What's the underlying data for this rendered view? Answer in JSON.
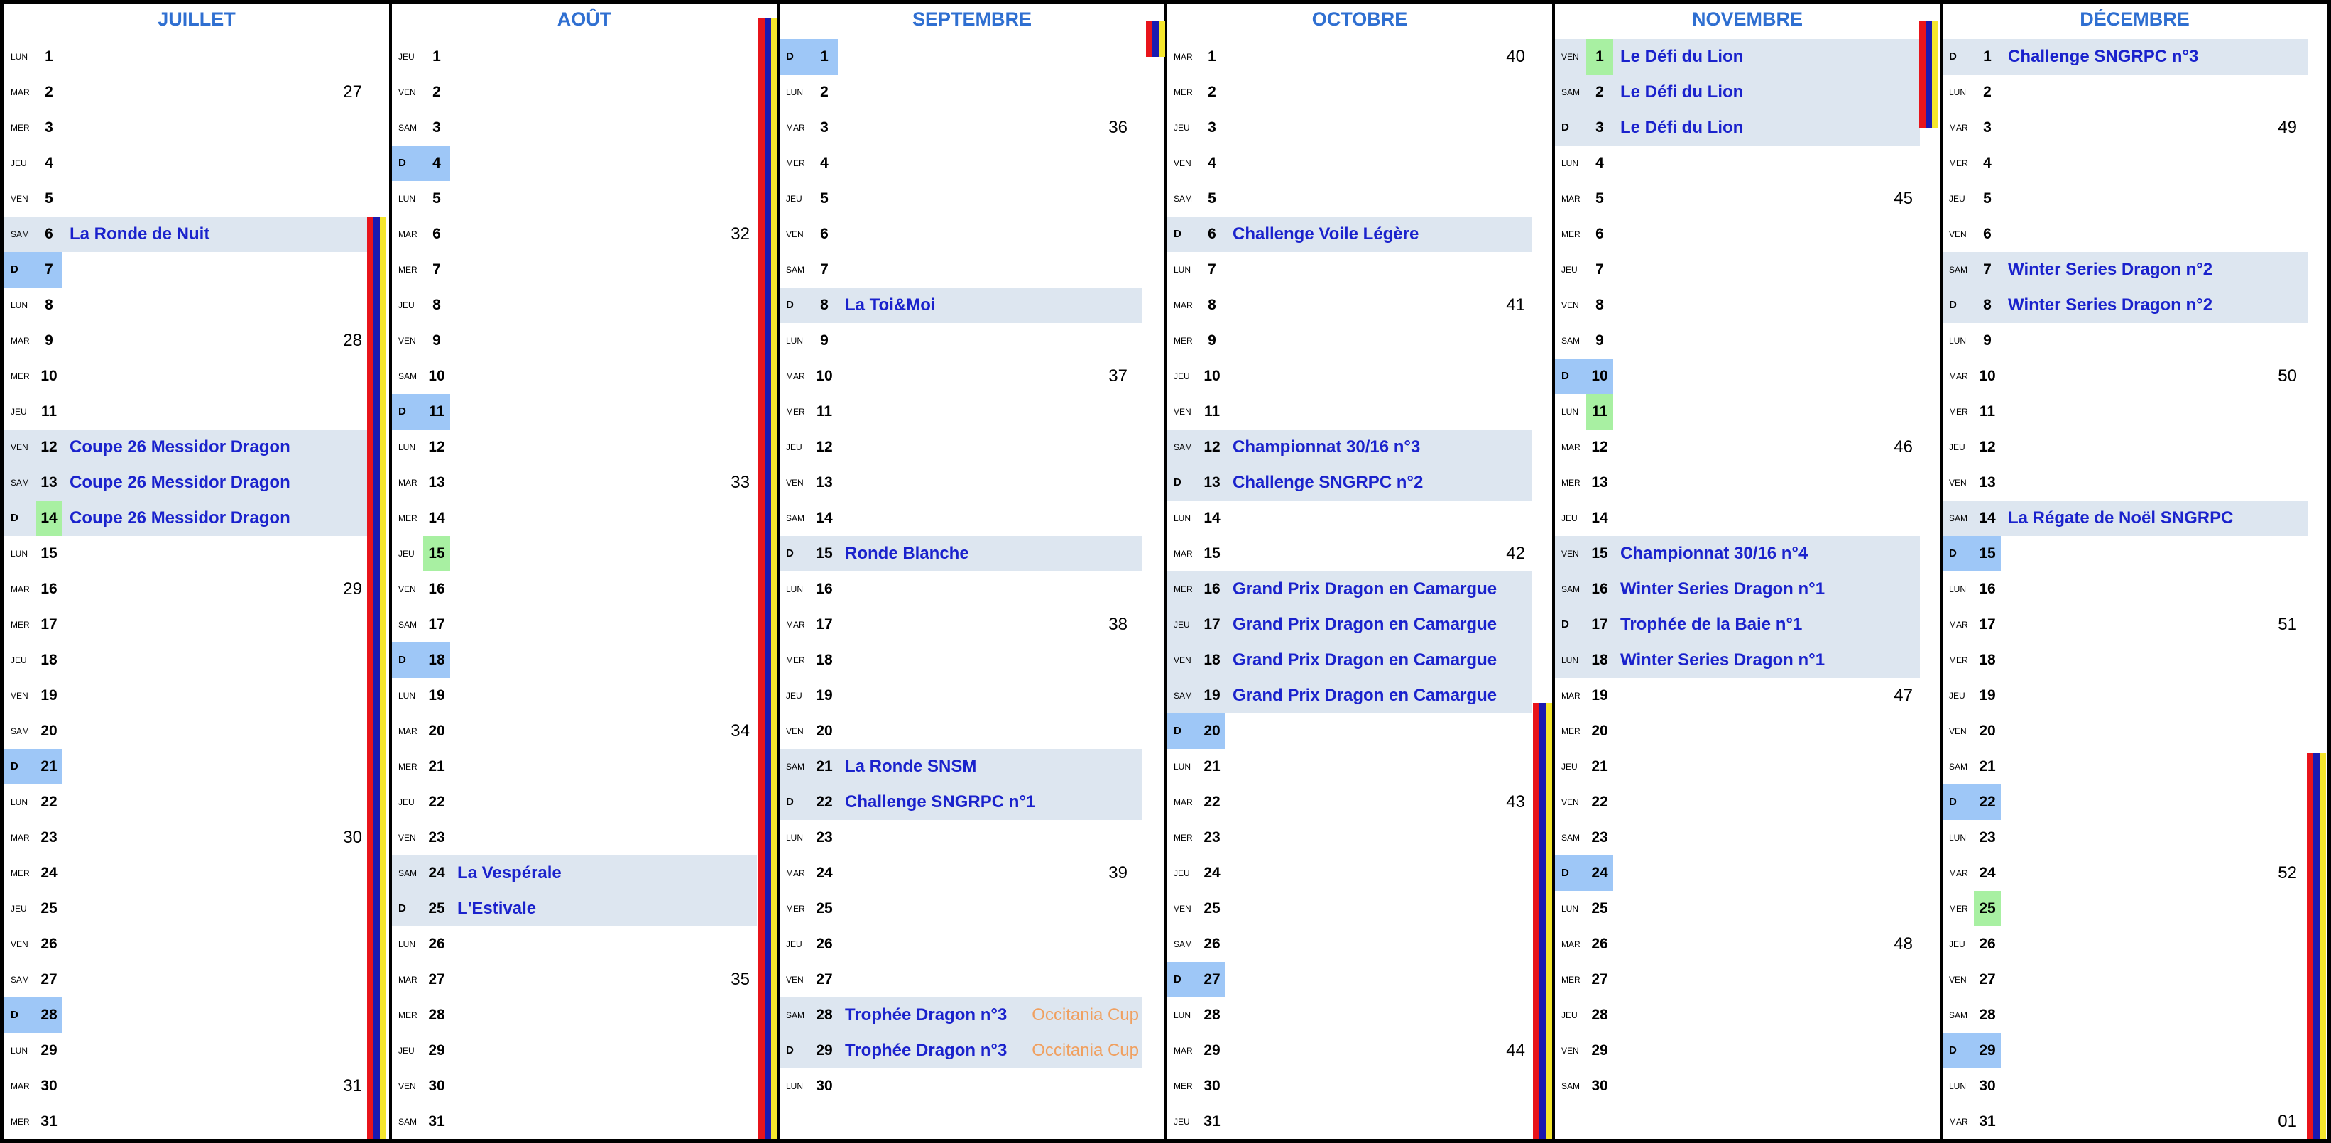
{
  "colors": {
    "month_title": "#2f6fd1",
    "event_text": "#1a22cc",
    "event_note": "#f0a060",
    "event_bg": "#dde6f0",
    "sunday_bg": "#9ec7f7",
    "holiday_bg": "#a8f0a2",
    "stripe": [
      "#e8141b",
      "#1a1ab0",
      "#f5e62c"
    ]
  },
  "months": [
    {
      "name": "JUILLET",
      "days": [
        {
          "wd": "LUN",
          "n": "1"
        },
        {
          "wd": "MAR",
          "n": "2",
          "week": "27"
        },
        {
          "wd": "MER",
          "n": "3"
        },
        {
          "wd": "JEU",
          "n": "4"
        },
        {
          "wd": "VEN",
          "n": "5"
        },
        {
          "wd": "SAM",
          "n": "6",
          "ev": "La Ronde de Nuit"
        },
        {
          "wd": "D",
          "n": "7",
          "sun": true
        },
        {
          "wd": "LUN",
          "n": "8"
        },
        {
          "wd": "MAR",
          "n": "9",
          "week": "28"
        },
        {
          "wd": "MER",
          "n": "10"
        },
        {
          "wd": "JEU",
          "n": "11"
        },
        {
          "wd": "VEN",
          "n": "12",
          "ev": "Coupe 26 Messidor Dragon"
        },
        {
          "wd": "SAM",
          "n": "13",
          "ev": "Coupe 26 Messidor Dragon"
        },
        {
          "wd": "D",
          "n": "14",
          "holiday": true,
          "ev": "Coupe 26 Messidor Dragon"
        },
        {
          "wd": "LUN",
          "n": "15"
        },
        {
          "wd": "MAR",
          "n": "16",
          "week": "29"
        },
        {
          "wd": "MER",
          "n": "17"
        },
        {
          "wd": "JEU",
          "n": "18"
        },
        {
          "wd": "VEN",
          "n": "19"
        },
        {
          "wd": "SAM",
          "n": "20"
        },
        {
          "wd": "D",
          "n": "21",
          "sun": true
        },
        {
          "wd": "LUN",
          "n": "22"
        },
        {
          "wd": "MAR",
          "n": "23",
          "week": "30"
        },
        {
          "wd": "MER",
          "n": "24"
        },
        {
          "wd": "JEU",
          "n": "25"
        },
        {
          "wd": "VEN",
          "n": "26"
        },
        {
          "wd": "SAM",
          "n": "27"
        },
        {
          "wd": "D",
          "n": "28",
          "sun": true
        },
        {
          "wd": "LUN",
          "n": "29"
        },
        {
          "wd": "MAR",
          "n": "30",
          "week": "31"
        },
        {
          "wd": "MER",
          "n": "31"
        }
      ]
    },
    {
      "name": "AOÛT",
      "days": [
        {
          "wd": "JEU",
          "n": "1"
        },
        {
          "wd": "VEN",
          "n": "2"
        },
        {
          "wd": "SAM",
          "n": "3"
        },
        {
          "wd": "D",
          "n": "4",
          "sun": true
        },
        {
          "wd": "LUN",
          "n": "5"
        },
        {
          "wd": "MAR",
          "n": "6",
          "week": "32"
        },
        {
          "wd": "MER",
          "n": "7"
        },
        {
          "wd": "JEU",
          "n": "8"
        },
        {
          "wd": "VEN",
          "n": "9"
        },
        {
          "wd": "SAM",
          "n": "10"
        },
        {
          "wd": "D",
          "n": "11",
          "sun": true
        },
        {
          "wd": "LUN",
          "n": "12"
        },
        {
          "wd": "MAR",
          "n": "13",
          "week": "33"
        },
        {
          "wd": "MER",
          "n": "14"
        },
        {
          "wd": "JEU",
          "n": "15",
          "holiday": true
        },
        {
          "wd": "VEN",
          "n": "16"
        },
        {
          "wd": "SAM",
          "n": "17"
        },
        {
          "wd": "D",
          "n": "18",
          "sun": true
        },
        {
          "wd": "LUN",
          "n": "19"
        },
        {
          "wd": "MAR",
          "n": "20",
          "week": "34"
        },
        {
          "wd": "MER",
          "n": "21"
        },
        {
          "wd": "JEU",
          "n": "22"
        },
        {
          "wd": "VEN",
          "n": "23"
        },
        {
          "wd": "SAM",
          "n": "24",
          "ev": "La Vespérale"
        },
        {
          "wd": "D",
          "n": "25",
          "ev": "L'Estivale"
        },
        {
          "wd": "LUN",
          "n": "26"
        },
        {
          "wd": "MAR",
          "n": "27",
          "week": "35"
        },
        {
          "wd": "MER",
          "n": "28"
        },
        {
          "wd": "JEU",
          "n": "29"
        },
        {
          "wd": "VEN",
          "n": "30"
        },
        {
          "wd": "SAM",
          "n": "31"
        }
      ]
    },
    {
      "name": "SEPTEMBRE",
      "days": [
        {
          "wd": "D",
          "n": "1",
          "sun": true
        },
        {
          "wd": "LUN",
          "n": "2"
        },
        {
          "wd": "MAR",
          "n": "3",
          "week": "36"
        },
        {
          "wd": "MER",
          "n": "4"
        },
        {
          "wd": "JEU",
          "n": "5"
        },
        {
          "wd": "VEN",
          "n": "6"
        },
        {
          "wd": "SAM",
          "n": "7"
        },
        {
          "wd": "D",
          "n": "8",
          "ev": "La Toi&Moi"
        },
        {
          "wd": "LUN",
          "n": "9"
        },
        {
          "wd": "MAR",
          "n": "10",
          "week": "37"
        },
        {
          "wd": "MER",
          "n": "11"
        },
        {
          "wd": "JEU",
          "n": "12"
        },
        {
          "wd": "VEN",
          "n": "13"
        },
        {
          "wd": "SAM",
          "n": "14"
        },
        {
          "wd": "D",
          "n": "15",
          "ev": "Ronde Blanche"
        },
        {
          "wd": "LUN",
          "n": "16"
        },
        {
          "wd": "MAR",
          "n": "17",
          "week": "38"
        },
        {
          "wd": "MER",
          "n": "18"
        },
        {
          "wd": "JEU",
          "n": "19"
        },
        {
          "wd": "VEN",
          "n": "20"
        },
        {
          "wd": "SAM",
          "n": "21",
          "ev": "La Ronde SNSM"
        },
        {
          "wd": "D",
          "n": "22",
          "ev": "Challenge SNGRPC n°1"
        },
        {
          "wd": "LUN",
          "n": "23"
        },
        {
          "wd": "MAR",
          "n": "24",
          "week": "39"
        },
        {
          "wd": "MER",
          "n": "25"
        },
        {
          "wd": "JEU",
          "n": "26"
        },
        {
          "wd": "VEN",
          "n": "27"
        },
        {
          "wd": "SAM",
          "n": "28",
          "ev": "Trophée Dragon n°3",
          "note": "Occitania Cup"
        },
        {
          "wd": "D",
          "n": "29",
          "ev": "Trophée Dragon n°3",
          "note": "Occitania Cup"
        },
        {
          "wd": "LUN",
          "n": "30"
        }
      ]
    },
    {
      "name": "OCTOBRE",
      "days": [
        {
          "wd": "MAR",
          "n": "1",
          "week": "40"
        },
        {
          "wd": "MER",
          "n": "2"
        },
        {
          "wd": "JEU",
          "n": "3"
        },
        {
          "wd": "VEN",
          "n": "4"
        },
        {
          "wd": "SAM",
          "n": "5"
        },
        {
          "wd": "D",
          "n": "6",
          "ev": "Challenge Voile Légère"
        },
        {
          "wd": "LUN",
          "n": "7"
        },
        {
          "wd": "MAR",
          "n": "8",
          "week": "41"
        },
        {
          "wd": "MER",
          "n": "9"
        },
        {
          "wd": "JEU",
          "n": "10"
        },
        {
          "wd": "VEN",
          "n": "11"
        },
        {
          "wd": "SAM",
          "n": "12",
          "ev": "Championnat 30/16 n°3"
        },
        {
          "wd": "D",
          "n": "13",
          "ev": "Challenge SNGRPC n°2"
        },
        {
          "wd": "LUN",
          "n": "14"
        },
        {
          "wd": "MAR",
          "n": "15",
          "week": "42"
        },
        {
          "wd": "MER",
          "n": "16",
          "ev": "Grand Prix Dragon en Camargue"
        },
        {
          "wd": "JEU",
          "n": "17",
          "ev": "Grand Prix Dragon en Camargue"
        },
        {
          "wd": "VEN",
          "n": "18",
          "ev": "Grand Prix Dragon en Camargue"
        },
        {
          "wd": "SAM",
          "n": "19",
          "ev": "Grand Prix Dragon en Camargue"
        },
        {
          "wd": "D",
          "n": "20",
          "sun": true
        },
        {
          "wd": "LUN",
          "n": "21"
        },
        {
          "wd": "MAR",
          "n": "22",
          "week": "43"
        },
        {
          "wd": "MER",
          "n": "23"
        },
        {
          "wd": "JEU",
          "n": "24"
        },
        {
          "wd": "VEN",
          "n": "25"
        },
        {
          "wd": "SAM",
          "n": "26"
        },
        {
          "wd": "D",
          "n": "27",
          "sun": true
        },
        {
          "wd": "LUN",
          "n": "28"
        },
        {
          "wd": "MAR",
          "n": "29",
          "week": "44"
        },
        {
          "wd": "MER",
          "n": "30"
        },
        {
          "wd": "JEU",
          "n": "31"
        }
      ]
    },
    {
      "name": "NOVEMBRE",
      "days": [
        {
          "wd": "VEN",
          "n": "1",
          "holiday": true,
          "ev": "Le Défi du Lion"
        },
        {
          "wd": "SAM",
          "n": "2",
          "ev": "Le Défi du Lion"
        },
        {
          "wd": "D",
          "n": "3",
          "ev": "Le Défi du Lion"
        },
        {
          "wd": "LUN",
          "n": "4"
        },
        {
          "wd": "MAR",
          "n": "5",
          "week": "45"
        },
        {
          "wd": "MER",
          "n": "6"
        },
        {
          "wd": "JEU",
          "n": "7"
        },
        {
          "wd": "VEN",
          "n": "8"
        },
        {
          "wd": "SAM",
          "n": "9"
        },
        {
          "wd": "D",
          "n": "10",
          "sun": true
        },
        {
          "wd": "LUN",
          "n": "11",
          "holiday": true
        },
        {
          "wd": "MAR",
          "n": "12",
          "week": "46"
        },
        {
          "wd": "MER",
          "n": "13"
        },
        {
          "wd": "JEU",
          "n": "14"
        },
        {
          "wd": "VEN",
          "n": "15",
          "ev": "Championnat 30/16 n°4"
        },
        {
          "wd": "SAM",
          "n": "16",
          "ev": "Winter Series Dragon n°1"
        },
        {
          "wd": "D",
          "n": "17",
          "ev": "Trophée de la Baie n°1"
        },
        {
          "wd": "LUN",
          "n": "18",
          "ev": "Winter Series Dragon n°1"
        },
        {
          "wd": "MAR",
          "n": "19",
          "week": "47"
        },
        {
          "wd": "MER",
          "n": "20"
        },
        {
          "wd": "JEU",
          "n": "21"
        },
        {
          "wd": "VEN",
          "n": "22"
        },
        {
          "wd": "SAM",
          "n": "23"
        },
        {
          "wd": "D",
          "n": "24",
          "sun": true
        },
        {
          "wd": "LUN",
          "n": "25"
        },
        {
          "wd": "MAR",
          "n": "26",
          "week": "48"
        },
        {
          "wd": "MER",
          "n": "27"
        },
        {
          "wd": "JEU",
          "n": "28"
        },
        {
          "wd": "VEN",
          "n": "29"
        },
        {
          "wd": "SAM",
          "n": "30"
        }
      ]
    },
    {
      "name": "DÉCEMBRE",
      "days": [
        {
          "wd": "D",
          "n": "1",
          "ev": "Challenge SNGRPC n°3"
        },
        {
          "wd": "LUN",
          "n": "2"
        },
        {
          "wd": "MAR",
          "n": "3",
          "week": "49"
        },
        {
          "wd": "MER",
          "n": "4"
        },
        {
          "wd": "JEU",
          "n": "5"
        },
        {
          "wd": "VEN",
          "n": "6"
        },
        {
          "wd": "SAM",
          "n": "7",
          "ev": "Winter Series Dragon n°2"
        },
        {
          "wd": "D",
          "n": "8",
          "ev": "Winter Series Dragon n°2"
        },
        {
          "wd": "LUN",
          "n": "9"
        },
        {
          "wd": "MAR",
          "n": "10",
          "week": "50"
        },
        {
          "wd": "MER",
          "n": "11"
        },
        {
          "wd": "JEU",
          "n": "12"
        },
        {
          "wd": "VEN",
          "n": "13"
        },
        {
          "wd": "SAM",
          "n": "14",
          "ev": "La Régate de Noël SNGRPC"
        },
        {
          "wd": "D",
          "n": "15",
          "sun": true
        },
        {
          "wd": "LUN",
          "n": "16"
        },
        {
          "wd": "MAR",
          "n": "17",
          "week": "51"
        },
        {
          "wd": "MER",
          "n": "18"
        },
        {
          "wd": "JEU",
          "n": "19"
        },
        {
          "wd": "VEN",
          "n": "20"
        },
        {
          "wd": "SAM",
          "n": "21"
        },
        {
          "wd": "D",
          "n": "22",
          "sun": true
        },
        {
          "wd": "LUN",
          "n": "23"
        },
        {
          "wd": "MAR",
          "n": "24",
          "week": "52"
        },
        {
          "wd": "MER",
          "n": "25",
          "holiday": true
        },
        {
          "wd": "JEU",
          "n": "26"
        },
        {
          "wd": "VEN",
          "n": "27"
        },
        {
          "wd": "SAM",
          "n": "28"
        },
        {
          "wd": "D",
          "n": "29",
          "sun": true
        },
        {
          "wd": "LUN",
          "n": "30"
        },
        {
          "wd": "MAR",
          "n": "31",
          "week": "01"
        }
      ]
    }
  ]
}
